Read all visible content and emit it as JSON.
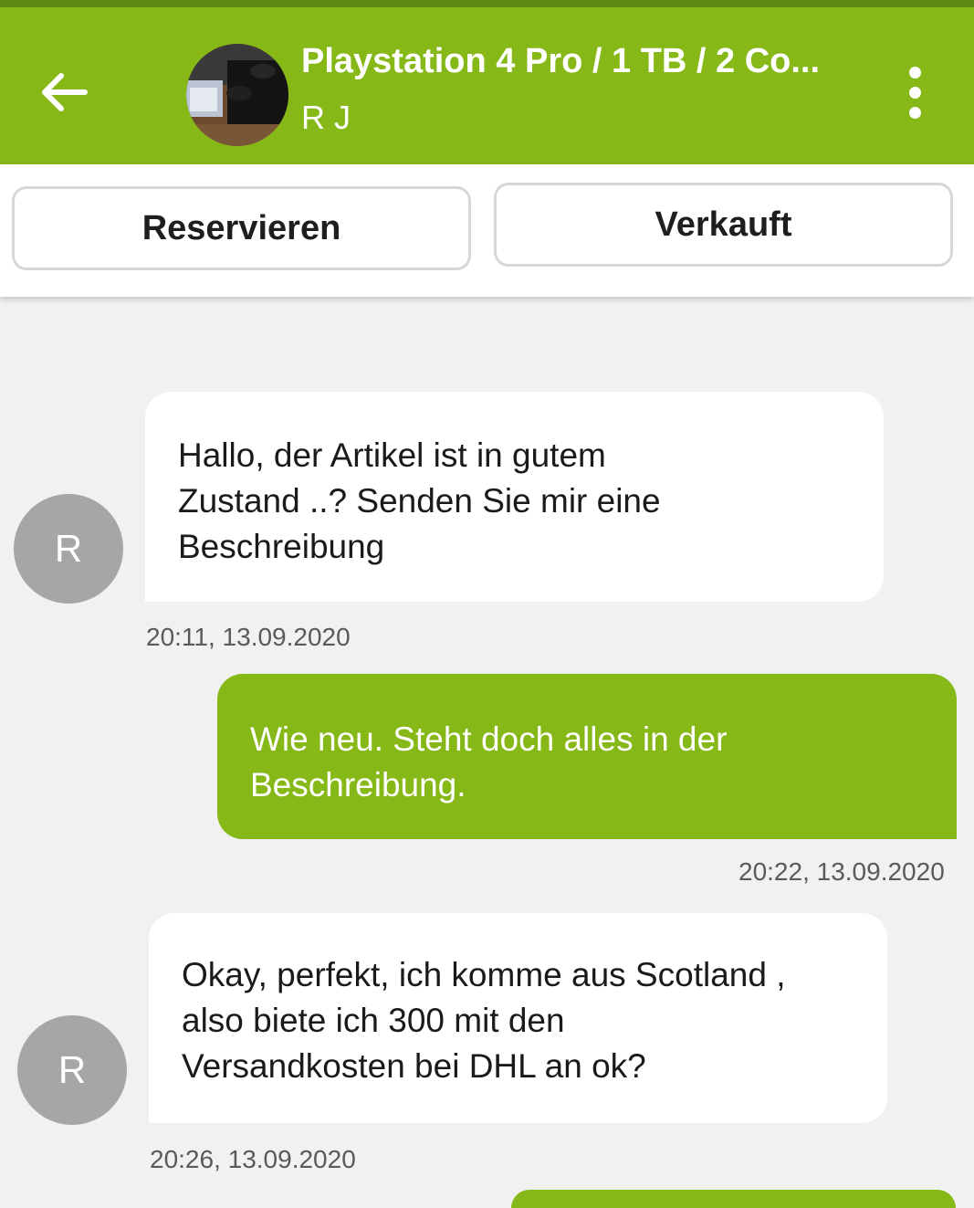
{
  "header": {
    "title": "Playstation 4 Pro / 1 TB / 2 Co...",
    "subtitle": "R J",
    "back_icon": "arrow-left-icon",
    "menu_icon": "more-vertical-icon",
    "colors": {
      "primary": "#86b817",
      "status": "#5f8a14"
    }
  },
  "actions": {
    "reserve_label": "Reservieren",
    "sold_label": "Verkauft"
  },
  "messages": [
    {
      "direction": "incoming",
      "avatar_initial": "R",
      "lines": [
        "Hallo, der Artikel ist in gutem",
        "Zustand ..? Senden Sie mir eine",
        "Beschreibung"
      ],
      "timestamp": "20:11, 13.09.2020"
    },
    {
      "direction": "outgoing",
      "lines": [
        "Wie neu. Steht doch alles in der",
        "Beschreibung."
      ],
      "timestamp": "20:22, 13.09.2020"
    },
    {
      "direction": "incoming",
      "avatar_initial": "R",
      "lines": [
        "Okay, perfekt, ich komme aus Scotland ,",
        "also biete ich 300 mit den",
        "Versandkosten bei DHL an ok?"
      ],
      "timestamp": "20:26, 13.09.2020"
    }
  ]
}
